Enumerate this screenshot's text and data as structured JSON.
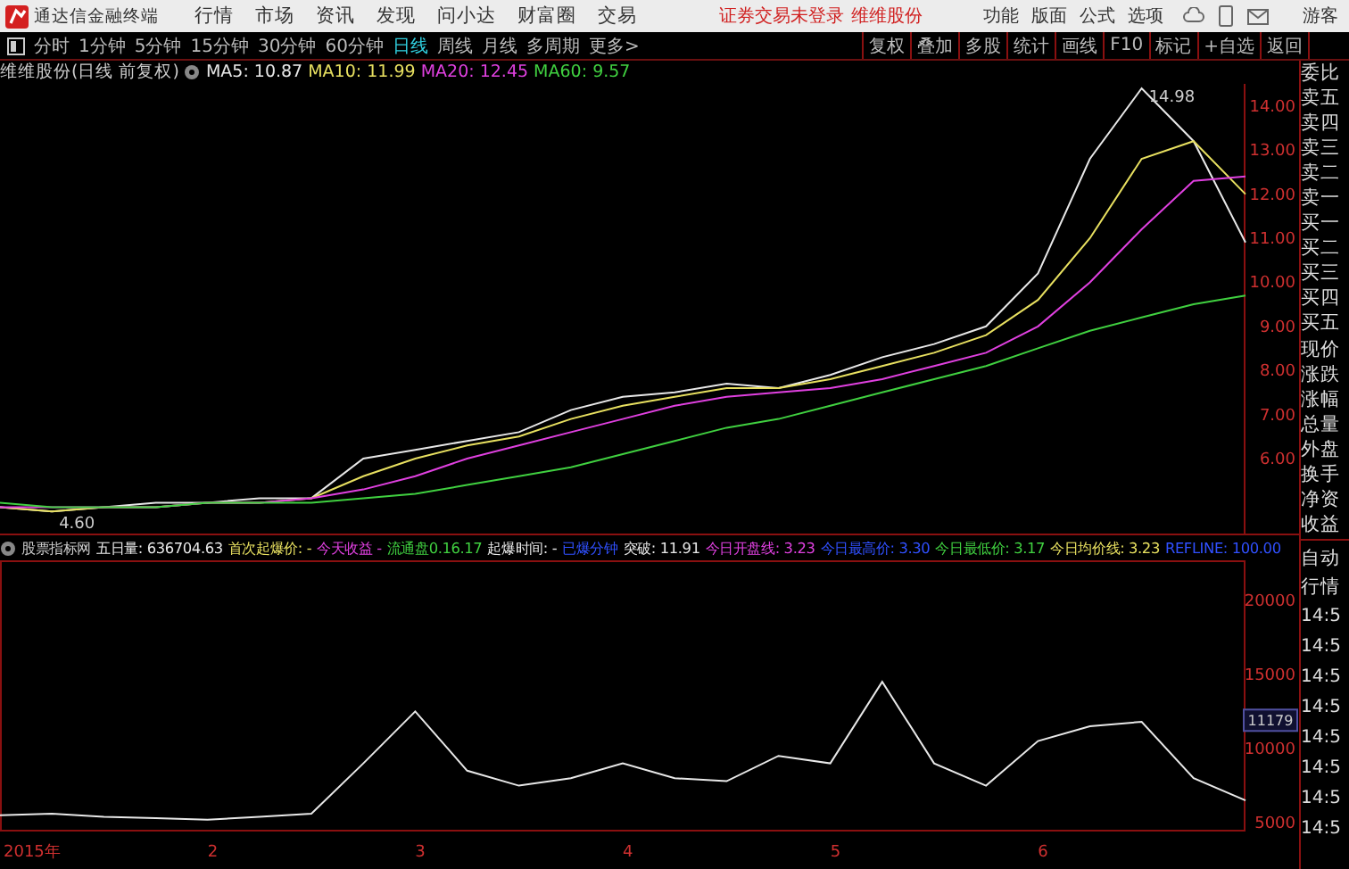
{
  "app_bar": {
    "title": "通达信金融终端",
    "menu": [
      "行情",
      "市场",
      "资讯",
      "发现",
      "问小达",
      "财富圈",
      "交易"
    ],
    "login_notice": "证券交易未登录",
    "stock_name": "维维股份",
    "right_menu": [
      "功能",
      "版面",
      "公式",
      "选项"
    ],
    "user": "游客"
  },
  "toolbar": {
    "periods": [
      {
        "label": "分时",
        "selected": false
      },
      {
        "label": "1分钟",
        "selected": false
      },
      {
        "label": "5分钟",
        "selected": false
      },
      {
        "label": "15分钟",
        "selected": false
      },
      {
        "label": "30分钟",
        "selected": false
      },
      {
        "label": "60分钟",
        "selected": false
      },
      {
        "label": "日线",
        "selected": true
      },
      {
        "label": "周线",
        "selected": false
      },
      {
        "label": "月线",
        "selected": false
      },
      {
        "label": "多周期",
        "selected": false
      },
      {
        "label": "更多>",
        "selected": false
      }
    ],
    "actions": [
      "复权",
      "叠加",
      "多股",
      "统计",
      "画线",
      "F10",
      "标记",
      "+自选",
      "返回"
    ]
  },
  "price_chart": {
    "title": "维维股份(日线 前复权)",
    "legend_values": [
      ": 10.87",
      ": 11.99",
      ": 12.45",
      ": 9.57"
    ],
    "chart_data": {
      "type": "line",
      "categories": [
        null,
        null,
        null,
        null,
        null,
        null,
        null,
        null,
        null,
        null,
        null,
        null,
        null,
        null,
        null,
        null,
        null,
        null,
        null,
        null,
        null,
        null,
        null,
        null,
        null
      ],
      "ylim": [
        4.3,
        14.5
      ],
      "yticks": [
        {
          "value": 14,
          "label": "14.00"
        },
        {
          "value": 13,
          "label": "13.00"
        },
        {
          "value": 12,
          "label": "12.00"
        },
        {
          "value": 11,
          "label": "11.00"
        },
        {
          "value": 10,
          "label": "10.00"
        },
        {
          "value": 9,
          "label": "9.00"
        },
        {
          "value": 8,
          "label": "8.00"
        },
        {
          "value": 7,
          "label": "7.00"
        },
        {
          "value": 6,
          "label": "6.00"
        }
      ],
      "series": [
        {
          "name": "MA5",
          "color": "#e8e8e8",
          "values": [
            4.9,
            4.8,
            4.9,
            5.0,
            5.0,
            5.1,
            5.1,
            6.0,
            6.2,
            6.4,
            6.6,
            7.1,
            7.4,
            7.5,
            7.7,
            7.6,
            7.9,
            8.3,
            8.6,
            9.0,
            10.2,
            12.8,
            14.4,
            13.2,
            10.9
          ]
        },
        {
          "name": "MA10",
          "color": "#e8e060",
          "values": [
            4.9,
            4.8,
            4.9,
            4.9,
            5.0,
            5.0,
            5.1,
            5.6,
            6.0,
            6.3,
            6.5,
            6.9,
            7.2,
            7.4,
            7.6,
            7.6,
            7.8,
            8.1,
            8.4,
            8.8,
            9.6,
            11.0,
            12.8,
            13.2,
            12.0
          ]
        },
        {
          "name": "MA20",
          "color": "#e040e0",
          "values": [
            4.9,
            4.9,
            4.9,
            4.9,
            5.0,
            5.0,
            5.1,
            5.3,
            5.6,
            6.0,
            6.3,
            6.6,
            6.9,
            7.2,
            7.4,
            7.5,
            7.6,
            7.8,
            8.1,
            8.4,
            9.0,
            10.0,
            11.2,
            12.3,
            12.4
          ]
        },
        {
          "name": "MA60",
          "color": "#40d040",
          "values": [
            5.0,
            4.9,
            4.9,
            4.9,
            5.0,
            5.0,
            5.0,
            5.1,
            5.2,
            5.4,
            5.6,
            5.8,
            6.1,
            6.4,
            6.7,
            6.9,
            7.2,
            7.5,
            7.8,
            8.1,
            8.5,
            8.9,
            9.2,
            9.5,
            9.7
          ]
        }
      ],
      "annotations": [
        "14.98",
        "4.60"
      ]
    }
  },
  "indicator_chart": {
    "title": "股票指标网",
    "year_label": "2015年",
    "series_value": ": 636704.63",
    "legend": [
      {
        "text": "首次起爆价: -",
        "color": "#e8e060"
      },
      {
        "text": "今天收益 -",
        "color": "#e040e0"
      },
      {
        "text": "流通盘0.16.17",
        "color": "#40d040"
      },
      {
        "text": "起爆时间: -",
        "color": "#e8e8e8"
      },
      {
        "text": "已爆分钟",
        "color": "#3050ff"
      },
      {
        "text": "突破: 11.91",
        "color": "#e8e8e8"
      },
      {
        "text": "今日开盘线: 3.23",
        "color": "#e040e0"
      },
      {
        "text": "今日最高价: 3.30",
        "color": "#3050ff"
      },
      {
        "text": "今日最低价: 3.17",
        "color": "#40d040"
      },
      {
        "text": "今日均价线: 3.23",
        "color": "#e8e060"
      },
      {
        "text": "REFLINE: 100.00",
        "color": "#3050ff"
      }
    ],
    "chart_data": {
      "type": "line",
      "x": [
        1,
        1.25,
        1.5,
        1.75,
        2,
        2.25,
        2.5,
        2.75,
        3,
        3.25,
        3.5,
        3.75,
        4,
        4.25,
        4.5,
        4.75,
        5,
        5.25,
        5.5,
        5.75,
        6,
        6.25,
        6.5,
        6.75,
        7
      ],
      "xlim": [
        1,
        7
      ],
      "ylim": [
        4400,
        22700
      ],
      "yticks": [
        {
          "value": 20000,
          "label": "20000"
        },
        {
          "value": 15000,
          "label": "15000"
        },
        {
          "value": 10000,
          "label": "10000"
        },
        {
          "value": 5000,
          "label": "5000"
        }
      ],
      "xticks": [
        2,
        3,
        4,
        5,
        6
      ],
      "series": [
        {
          "name": "五日量",
          "color": "#e8e8e8",
          "values": [
            5500,
            5600,
            5400,
            5300,
            5200,
            5400,
            5600,
            9000,
            12500,
            8500,
            7500,
            8000,
            9000,
            8000,
            7800,
            9500,
            9000,
            14500,
            9000,
            7500,
            10500,
            11500,
            11800,
            8000,
            6500
          ]
        }
      ],
      "annotations": [
        "11179"
      ]
    }
  },
  "quote_panel": {
    "labels": [
      "委比",
      "卖五",
      "卖四",
      "卖三",
      "卖二",
      "卖一",
      "买一",
      "买二",
      "买三",
      "买四",
      "买五",
      "现价",
      "涨跌",
      "涨幅",
      "总量",
      "外盘",
      "换手",
      "净资",
      "收益"
    ],
    "tabs": [
      "自动",
      "行情"
    ],
    "times": [
      "14:5",
      "14:5",
      "14:5",
      "14:5",
      "14:5",
      "14:5",
      "14:5",
      "14:5"
    ]
  }
}
